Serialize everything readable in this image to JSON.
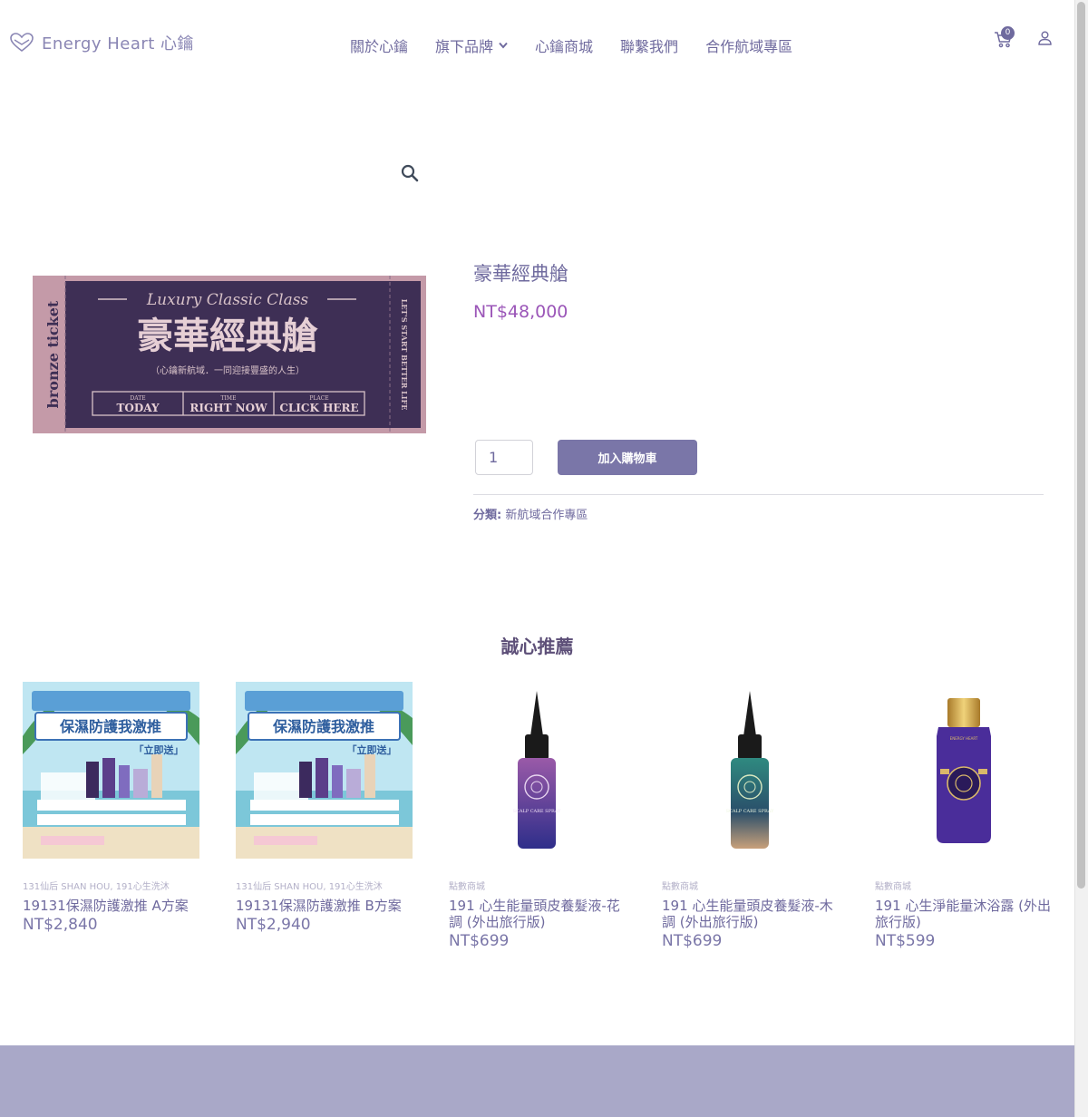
{
  "header": {
    "logo_text": "Energy Heart 心鑰",
    "nav": [
      {
        "label": "關於心鑰"
      },
      {
        "label": "旗下品牌"
      },
      {
        "label": "心鑰商城"
      },
      {
        "label": "聯繫我們"
      },
      {
        "label": "合作航域專區"
      }
    ],
    "cart_count": "0"
  },
  "product": {
    "title": "豪華經典艙",
    "price": "NT$48,000",
    "quantity": "1",
    "add_to_cart": "加入購物車",
    "category_label": "分類:",
    "category": "新航域合作專區",
    "ticket": {
      "side_left": "bronze ticket",
      "script_title": "Luxury Classic Class",
      "main_title": "豪華經典艙",
      "subtitle": "（心鑰新航域．一同迎接豐盛的人生）",
      "col1_top": "DATE",
      "col1_main": "TODAY",
      "col2_top": "TIME",
      "col2_main": "RIGHT NOW",
      "col3_top": "PLACE",
      "col3_main": "CLICK HERE",
      "side_right": "LET'S START BETTER LIFE"
    }
  },
  "recommend": {
    "title": "誠心推薦",
    "items": [
      {
        "category": "131仙后 SHAN HOU, 191心生洗沐",
        "name": "19131保濕防護激推 A方案",
        "price": "NT$2,840",
        "banner_line1": "保濕防護我激推",
        "banner_line2": "「立即送」"
      },
      {
        "category": "131仙后 SHAN HOU, 191心生洗沐",
        "name": "19131保濕防護激推 B方案",
        "price": "NT$2,940",
        "banner_line1": "保濕防護我激推",
        "banner_line2": "「立即送」"
      },
      {
        "category": "點數商城",
        "name": "191 心生能量頭皮養髮液-花調 (外出旅行版)",
        "price": "NT$699",
        "label": "SCALP CARE SPRAY"
      },
      {
        "category": "點數商城",
        "name": "191 心生能量頭皮養髮液-木調 (外出旅行版)",
        "price": "NT$699",
        "label": "SCALP CARE SPRAY"
      },
      {
        "category": "點數商城",
        "name": "191 心生淨能量沐浴露 (外出旅行版)",
        "price": "NT$599",
        "label": "ENERGY HEART"
      }
    ]
  },
  "colors": {
    "brand": "#6f6a9e",
    "price": "#9b56b8",
    "button": "#7a76a8",
    "footer": "#a9a8c8",
    "ticket_bg": "#3e2f55",
    "ticket_border": "#c49aa8"
  }
}
